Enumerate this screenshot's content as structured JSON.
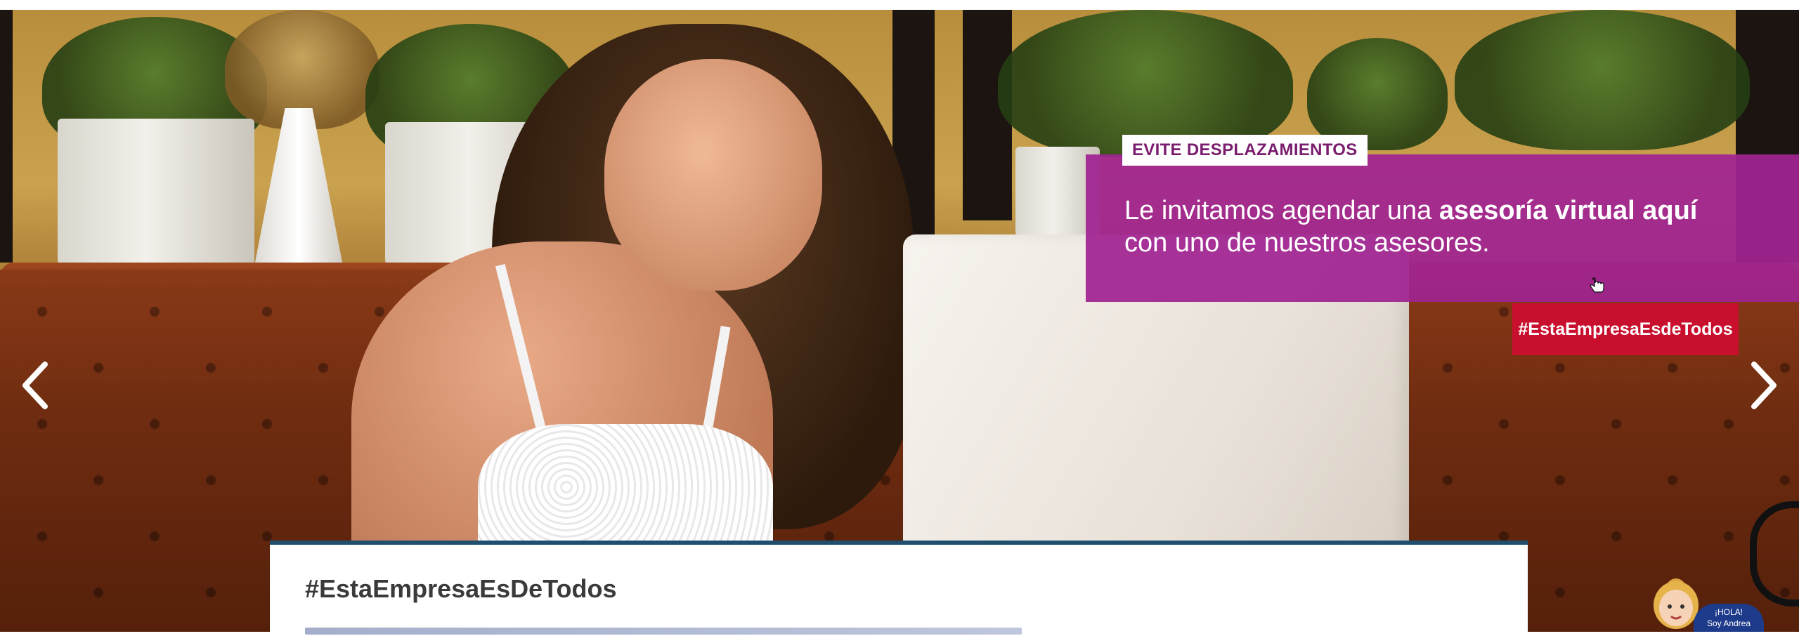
{
  "hero": {
    "promo_tag": "EVITE DESPLAZAMIENTOS",
    "promo_line1_prefix": "Le invitamos agendar una ",
    "promo_line1_bold": "asesoría virtual aquí",
    "promo_line2": "con uno de nuestros asesores.",
    "hashtag_badge": "#EstaEmpresaEsdeTodos",
    "prev_icon": "chevron-left-icon",
    "next_icon": "chevron-right-icon",
    "colors": {
      "promo_purple": "#a02391",
      "badge_red": "#c8102e",
      "card_border": "#1f4e6e"
    }
  },
  "card": {
    "title": "#EstaEmpresaEsDeTodos"
  },
  "mascot": {
    "badge_line1": "¡HOLA!",
    "badge_line2": "Soy Andrea"
  }
}
